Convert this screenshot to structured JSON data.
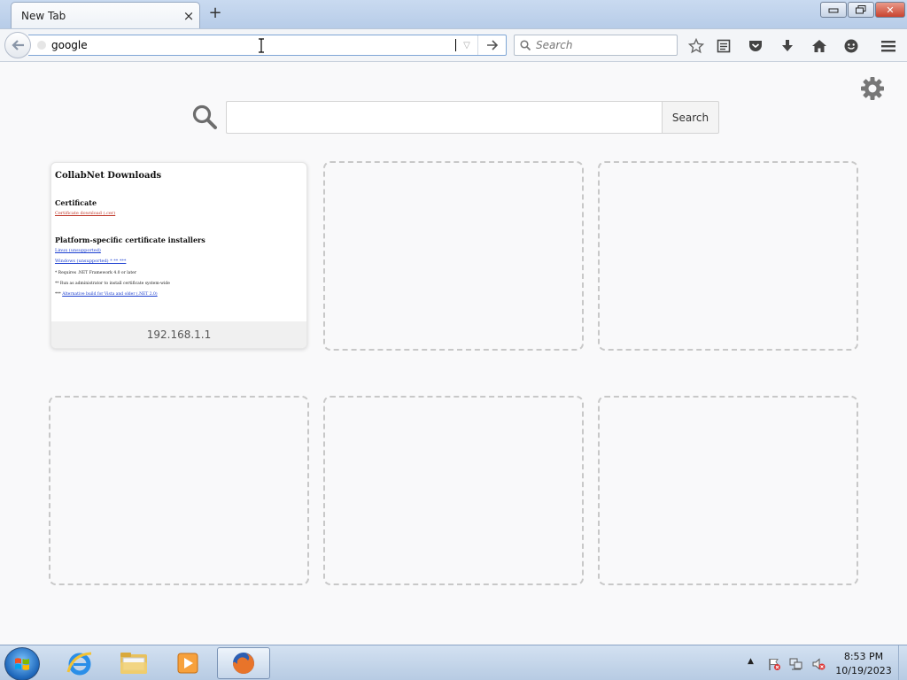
{
  "browser": {
    "tab": {
      "title": "New Tab",
      "close_glyph": "×"
    },
    "new_tab_glyph": "+",
    "window_controls": {
      "minimize": "▭",
      "maximize": "⧉",
      "close": "✕"
    },
    "url_bar": {
      "value": "google",
      "dropdown_glyph": "▽"
    },
    "search_bar": {
      "placeholder": "Search"
    },
    "toolbar_icons": [
      "bookmark-star-icon",
      "reading-list-icon",
      "pocket-icon",
      "download-icon",
      "home-icon",
      "hello-chat-icon",
      "menu-icon"
    ]
  },
  "newtab": {
    "search_button_label": "Search",
    "tiles": [
      {
        "caption": "192.168.1.1",
        "thumbnail": {
          "heading": "CollabNet Downloads",
          "section1_title": "Certificate",
          "section1_link": "Certificate download (.cer)",
          "section2_title": "Platform-specific certificate installers",
          "link_linux": "Linux (unsupported)",
          "link_windows": "Windows (unsupported) * ** ***",
          "note1": "* Requires .NET Framework 4.0 or later",
          "note2": "** Run as administrator to install certificate system-wide",
          "note3_prefix": "***",
          "note3_link": "Alternative build for Vista and older (.NET 2.0)"
        }
      },
      {
        "caption": ""
      },
      {
        "caption": ""
      },
      {
        "caption": ""
      },
      {
        "caption": ""
      },
      {
        "caption": ""
      }
    ]
  },
  "taskbar": {
    "apps": [
      "internet-explorer",
      "file-explorer",
      "media-player",
      "firefox"
    ],
    "clock": {
      "time": "8:53 PM",
      "date": "10/19/2023"
    },
    "tray_arrow": "▲"
  },
  "colors": {
    "accent": "#0a84ff",
    "tile_border": "#c8c8c8",
    "taskbar": "#b7cbe3"
  }
}
